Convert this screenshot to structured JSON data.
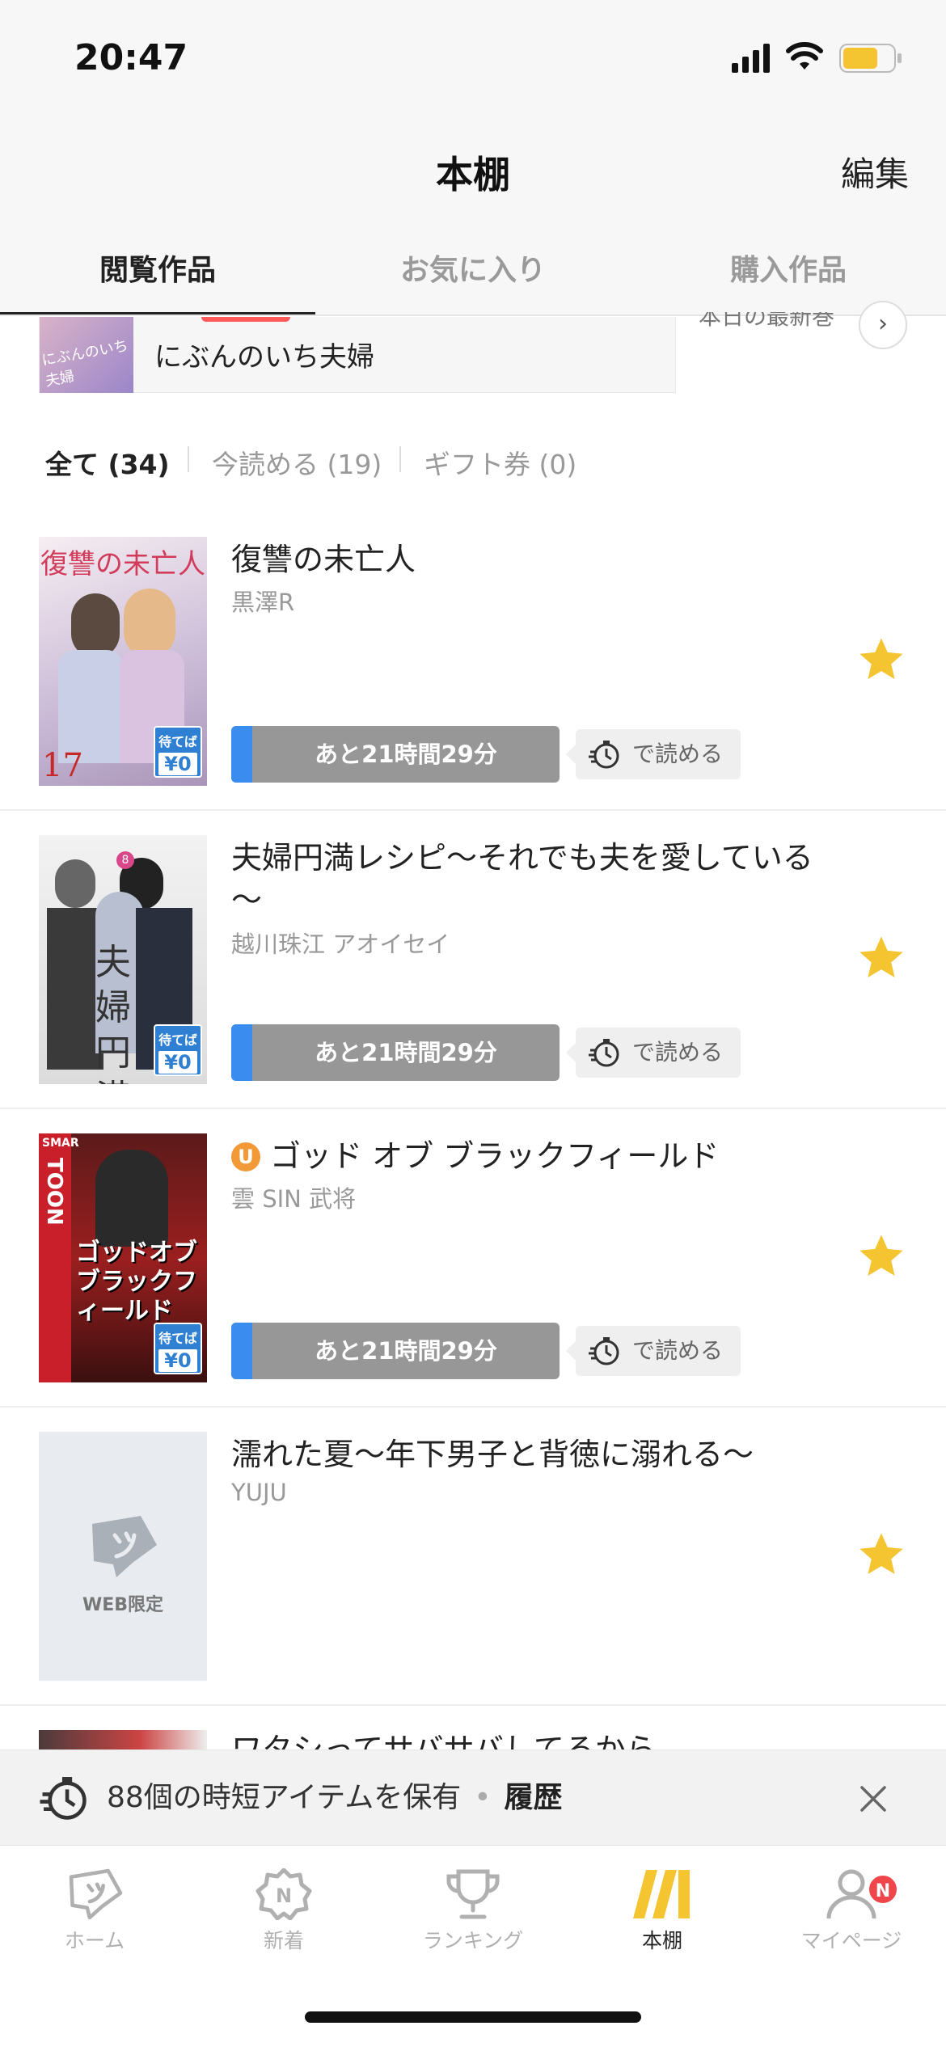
{
  "status": {
    "time": "20:47"
  },
  "header": {
    "title": "本棚",
    "edit_label": "編集"
  },
  "tabs": [
    {
      "label": "閲覧作品",
      "active": true
    },
    {
      "label": "お気に入り",
      "active": false
    },
    {
      "label": "購入作品",
      "active": false
    }
  ],
  "banner": {
    "thumb_text": "にぶんのいち夫婦",
    "title": "にぶんのいち夫婦",
    "right_text": "本日の最新巻"
  },
  "filters": [
    {
      "label": "全て (34)",
      "active": true
    },
    {
      "label": "今読める (19)",
      "active": false
    },
    {
      "label": "ギフト券 (0)",
      "active": false
    }
  ],
  "books": [
    {
      "title": "復讐の未亡人",
      "author": "黒澤R",
      "cover_text": "復讐の未亡人",
      "timer": "あと21時間29分",
      "readable": "で読める",
      "wait_badge": {
        "line1": "待てば",
        "line2": "¥0"
      },
      "favorite": true
    },
    {
      "title": "夫婦円満レシピ～それでも夫を愛している～",
      "author": "越川珠江 アオイセイ",
      "cover_text": "夫婦円満",
      "timer": "あと21時間29分",
      "readable": "で読める",
      "wait_badge": {
        "line1": "待てば",
        "line2": "¥0"
      },
      "favorite": true
    },
    {
      "title": "ゴッド オブ ブラックフィールド",
      "author": "雲 SIN 武将",
      "u_badge": "U",
      "cover_text": "ゴッドオブブラックフィールド",
      "cover_brand": "TOON",
      "timer": "あと21時間29分",
      "readable": "で読める",
      "wait_badge": {
        "line1": "待てば",
        "line2": "¥0"
      },
      "favorite": true
    },
    {
      "title": "濡れた夏～年下男子と背徳に溺れる～",
      "author": "YUJU",
      "cover_text": "WEB限定",
      "favorite": true
    }
  ],
  "partial_book": {
    "title": "ワタシってサバサバしてるから"
  },
  "notice": {
    "text": "88個の時短アイテムを保有",
    "dot": "•",
    "history": "履歴"
  },
  "nav": [
    {
      "label": "ホーム",
      "icon": "home-icon",
      "active": false
    },
    {
      "label": "新着",
      "icon": "new-icon",
      "active": false
    },
    {
      "label": "ランキング",
      "icon": "trophy-icon",
      "active": false
    },
    {
      "label": "本棚",
      "icon": "bookshelf-icon",
      "active": true
    },
    {
      "label": "マイページ",
      "icon": "user-icon",
      "active": false,
      "badge": "N"
    }
  ],
  "colors": {
    "accent_blue": "#3b8cef",
    "star": "#f5c431",
    "active_nav": "#f5c431",
    "badge_red": "#f0454a"
  }
}
